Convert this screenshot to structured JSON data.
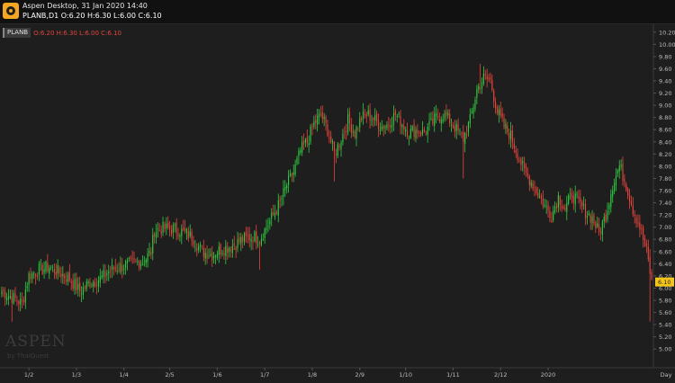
{
  "window": {
    "title": "Aspen Desktop, 31 Jan 2020 14:40",
    "quote_line": "PLANB,D1 O:6.20 H:6.30 L:6.00 C:6.10"
  },
  "legend": {
    "symbol": "PLANB",
    "ohlc": "O:6.20 H:6.30 L:6.00 C:6.10"
  },
  "watermark": {
    "brand": "ASPEN",
    "sub": "by ThaiQuest"
  },
  "colors": {
    "background": "#1e1e1e",
    "up": "#2ecc40",
    "down": "#e8453c",
    "last_price_tag": "#f5c518",
    "axis_text": "#bdbdbd",
    "grid": "#2a2a2a"
  },
  "chart_data": {
    "type": "candlestick",
    "symbol": "PLANB",
    "timeframe": "Day",
    "y_axis_position": "right",
    "ylim": [
      4.9,
      10.3
    ],
    "y_ticks": [
      "10.20",
      "10.00",
      "9.80",
      "9.60",
      "9.40",
      "9.20",
      "9.00",
      "8.80",
      "8.60",
      "8.40",
      "8.20",
      "8.00",
      "7.80",
      "7.60",
      "7.40",
      "7.20",
      "7.00",
      "6.80",
      "6.60",
      "6.40",
      "6.20",
      "6.00",
      "5.80",
      "5.60",
      "5.40",
      "5.20",
      "5.00"
    ],
    "x_ticks": [
      "1/2",
      "1/3",
      "1/4",
      "2/5",
      "1/6",
      "1/7",
      "1/8",
      "2/9",
      "1/10",
      "1/11",
      "2/12",
      "2020"
    ],
    "x_axis_unit": "Day",
    "last_price": "6.10",
    "grid": false,
    "anchors": [
      [
        0,
        5.95
      ],
      [
        6,
        5.85
      ],
      [
        12,
        5.75
      ],
      [
        16,
        6.2
      ],
      [
        22,
        6.3
      ],
      [
        28,
        6.35
      ],
      [
        34,
        6.25
      ],
      [
        40,
        6.15
      ],
      [
        46,
        5.95
      ],
      [
        52,
        6.1
      ],
      [
        58,
        6.15
      ],
      [
        64,
        6.3
      ],
      [
        70,
        6.35
      ],
      [
        76,
        6.4
      ],
      [
        84,
        6.45
      ],
      [
        88,
        6.6
      ],
      [
        90,
        6.95
      ],
      [
        96,
        6.98
      ],
      [
        104,
        6.95
      ],
      [
        112,
        6.85
      ],
      [
        118,
        6.6
      ],
      [
        124,
        6.55
      ],
      [
        130,
        6.65
      ],
      [
        136,
        6.7
      ],
      [
        142,
        6.8
      ],
      [
        148,
        6.85
      ],
      [
        152,
        6.8
      ],
      [
        158,
        7.1
      ],
      [
        164,
        7.4
      ],
      [
        168,
        7.7
      ],
      [
        172,
        7.9
      ],
      [
        176,
        8.25
      ],
      [
        180,
        8.4
      ],
      [
        184,
        8.7
      ],
      [
        188,
        8.85
      ],
      [
        192,
        8.6
      ],
      [
        196,
        8.2
      ],
      [
        200,
        8.45
      ],
      [
        204,
        8.75
      ],
      [
        208,
        8.55
      ],
      [
        212,
        8.8
      ],
      [
        216,
        8.85
      ],
      [
        220,
        8.75
      ],
      [
        224,
        8.65
      ],
      [
        228,
        8.7
      ],
      [
        232,
        8.85
      ],
      [
        236,
        8.7
      ],
      [
        240,
        8.55
      ],
      [
        244,
        8.6
      ],
      [
        248,
        8.55
      ],
      [
        252,
        8.65
      ],
      [
        256,
        8.8
      ],
      [
        260,
        8.85
      ],
      [
        264,
        8.75
      ],
      [
        268,
        8.6
      ],
      [
        272,
        8.45
      ],
      [
        276,
        8.75
      ],
      [
        280,
        9.25
      ],
      [
        284,
        9.45
      ],
      [
        288,
        9.4
      ],
      [
        292,
        8.9
      ],
      [
        296,
        8.65
      ],
      [
        300,
        8.5
      ],
      [
        304,
        8.2
      ],
      [
        308,
        7.9
      ],
      [
        312,
        7.75
      ],
      [
        316,
        7.55
      ],
      [
        320,
        7.35
      ],
      [
        324,
        7.2
      ],
      [
        328,
        7.5
      ],
      [
        332,
        7.3
      ],
      [
        336,
        7.55
      ],
      [
        340,
        7.4
      ],
      [
        344,
        7.25
      ],
      [
        348,
        7.15
      ],
      [
        352,
        6.9
      ],
      [
        356,
        7.2
      ],
      [
        360,
        7.7
      ],
      [
        364,
        8.0
      ],
      [
        368,
        7.7
      ],
      [
        372,
        7.3
      ],
      [
        376,
        7.0
      ],
      [
        380,
        6.6
      ],
      [
        383,
        6.1
      ]
    ],
    "notable_lows": [
      [
        6,
        5.45
      ],
      [
        152,
        6.3
      ],
      [
        196,
        7.75
      ],
      [
        272,
        7.8
      ],
      [
        382,
        5.45
      ]
    ],
    "notable_highs": [
      [
        282,
        9.68
      ],
      [
        364,
        8.1
      ]
    ]
  }
}
